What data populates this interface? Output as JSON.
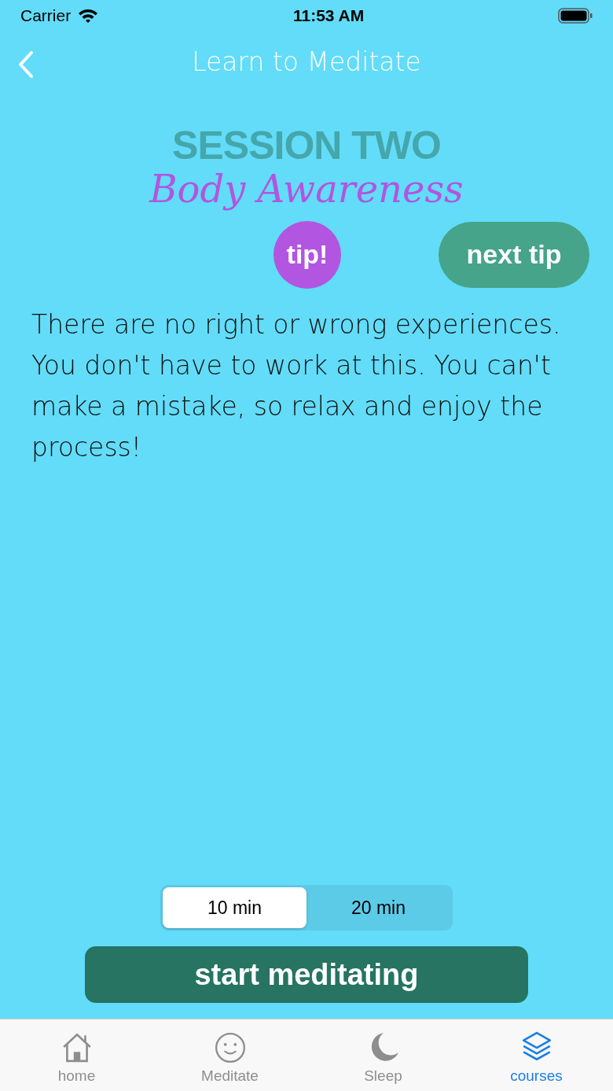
{
  "status_bar": {
    "carrier": "Carrier",
    "time": "11:53 AM"
  },
  "nav": {
    "title": "Learn to Meditate"
  },
  "session": {
    "label": "SESSION TWO",
    "name": "Body Awareness"
  },
  "tip_badge": "tip!",
  "next_tip_button": "next tip",
  "tip_text": "There are no right or wrong experiences. You don't have to work at this. You can't make a mistake, so relax and enjoy the process!",
  "durations": [
    {
      "label": "10 min",
      "selected": true
    },
    {
      "label": "20 min",
      "selected": false
    }
  ],
  "start_button": "start meditating",
  "tab_bar": [
    {
      "label": "home",
      "kind": "home",
      "selected": false
    },
    {
      "label": "Meditate",
      "kind": "smile",
      "selected": false
    },
    {
      "label": "Sleep",
      "kind": "moon",
      "selected": false
    },
    {
      "label": "courses",
      "kind": "layers",
      "selected": true
    }
  ]
}
